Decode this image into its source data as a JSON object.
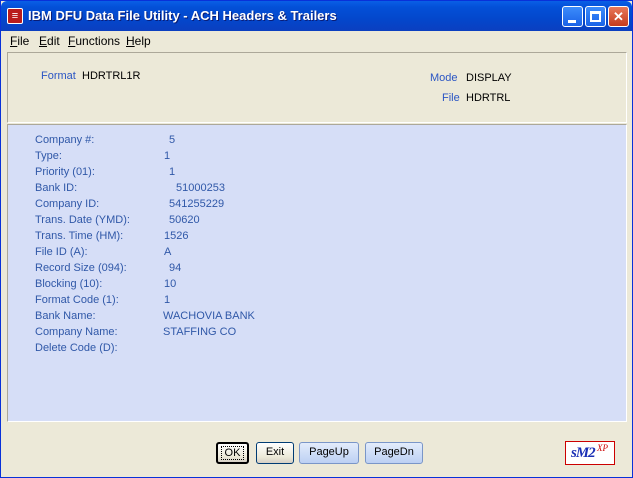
{
  "window": {
    "title": "IBM DFU Data File Utility - ACH Headers & Trailers",
    "app_icon": "dfu-app-icon"
  },
  "menu": [
    "File",
    "Edit",
    "Functions",
    "Help"
  ],
  "header": {
    "format_label": "Format",
    "format_value": "HDRTRL1R",
    "mode_label": "Mode",
    "mode_value": "DISPLAY",
    "file_label": "File",
    "file_value": "HDRTRL"
  },
  "fields": [
    {
      "label": "Company #:",
      "value": "5"
    },
    {
      "label": "Type:",
      "value": "1"
    },
    {
      "label": "Priority (01):",
      "value": "1"
    },
    {
      "label": "Bank ID:",
      "value": "51000253"
    },
    {
      "label": "Company ID:",
      "value": "541255229"
    },
    {
      "label": "Trans. Date (YMD):",
      "value": "50620"
    },
    {
      "label": "Trans. Time (HM):",
      "value": "1526"
    },
    {
      "label": "File ID (A):",
      "value": "A"
    },
    {
      "label": "Record Size (094):",
      "value": "94"
    },
    {
      "label": "Blocking (10):",
      "value": "10"
    },
    {
      "label": "Format Code (1):",
      "value": "1"
    },
    {
      "label": "Bank Name:",
      "value": "WACHOVIA BANK"
    },
    {
      "label": "Company Name:",
      "value": "STAFFING CO"
    },
    {
      "label": "Delete Code (D):",
      "value": ""
    }
  ],
  "buttons": {
    "ok": "OK",
    "exit": "Exit",
    "page_up": "PageUp",
    "page_down": "PageDn"
  },
  "logo": {
    "main": "sM2",
    "sup": "XP"
  }
}
